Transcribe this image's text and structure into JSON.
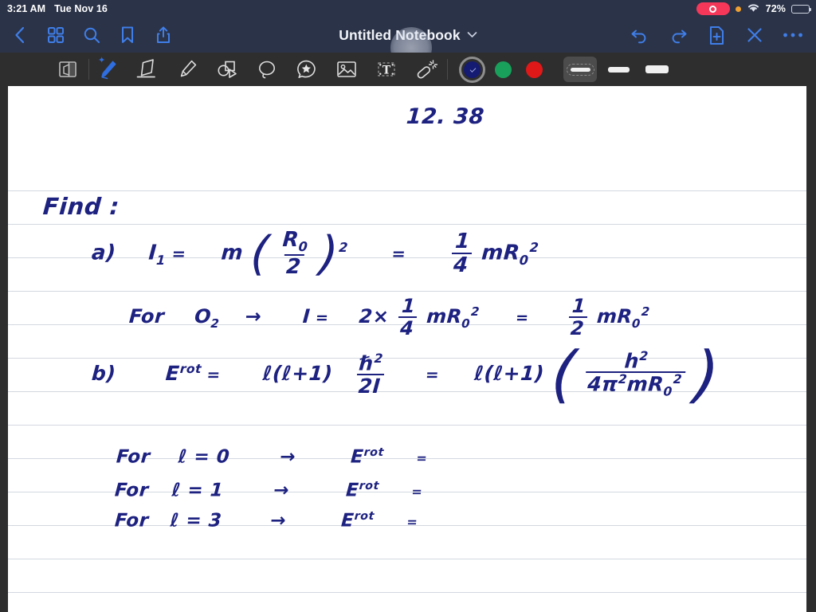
{
  "status_bar": {
    "time": "3:21 AM",
    "date": "Tue Nov 16",
    "battery_percent": "72%",
    "battery_level": 72,
    "recording_indicator": "recording-pill-icon",
    "privacy_dot": "orange-privacy-dot-icon",
    "wifi": "wifi-icon",
    "colors": {
      "bar_bg": "#2b3348",
      "recording_red": "#f5385a",
      "privacy_orange": "#f0a030"
    }
  },
  "nav_bar": {
    "title": "Untitled Notebook",
    "title_chevron": "chevron-down-icon",
    "left_icons": [
      {
        "name": "back-icon",
        "label": "Back"
      },
      {
        "name": "grid-icon",
        "label": "Page Grid"
      },
      {
        "name": "search-icon",
        "label": "Search"
      },
      {
        "name": "bookmark-icon",
        "label": "Bookmark"
      },
      {
        "name": "share-icon",
        "label": "Share"
      }
    ],
    "right_icons": [
      {
        "name": "undo-icon",
        "label": "Undo"
      },
      {
        "name": "redo-icon",
        "label": "Redo"
      },
      {
        "name": "new-page-icon",
        "label": "New Page"
      },
      {
        "name": "close-icon",
        "label": "Close"
      },
      {
        "name": "more-icon",
        "label": "More"
      }
    ],
    "touch_indicator": "touch-tap-indicator",
    "colors": {
      "bar_bg": "#2b3348",
      "icon_blue": "#3f7ee8",
      "title_text": "#f2f4f8"
    }
  },
  "tool_bar": {
    "background": "#2e2e2e",
    "tools": [
      {
        "name": "page-layers-tool",
        "label": "Page Layers",
        "selected": false
      },
      {
        "name": "pen-tool",
        "label": "Pen",
        "selected": true
      },
      {
        "name": "eraser-tool",
        "label": "Eraser",
        "selected": false
      },
      {
        "name": "highlighter-tool",
        "label": "Highlighter",
        "selected": false
      },
      {
        "name": "shapes-tool",
        "label": "Shapes",
        "selected": false
      },
      {
        "name": "lasso-tool",
        "label": "Lasso",
        "selected": false
      },
      {
        "name": "sticker-tool",
        "label": "Sticker",
        "selected": false
      },
      {
        "name": "image-tool",
        "label": "Image",
        "selected": false
      },
      {
        "name": "text-tool",
        "label": "Text",
        "selected": false
      },
      {
        "name": "magic-wand-tool",
        "label": "Magic Wand",
        "selected": false
      }
    ],
    "colors": [
      {
        "name": "color-swatch-navy",
        "hex": "#151a72",
        "selected": true
      },
      {
        "name": "color-swatch-green",
        "hex": "#19a05b",
        "selected": false
      },
      {
        "name": "color-swatch-red",
        "hex": "#e01818",
        "selected": false
      }
    ],
    "stroke_widths": [
      {
        "name": "stroke-width-thin",
        "label": "Thin",
        "selected": true
      },
      {
        "name": "stroke-width-medium",
        "label": "Medium",
        "selected": false
      },
      {
        "name": "stroke-width-thick",
        "label": "Thick",
        "selected": false
      }
    ]
  },
  "notebook_page": {
    "background": "#ffffff",
    "rule_color": "#d3d8e0",
    "rule_spacing": 42,
    "ink_color": "#1d2180",
    "problem_number": "12. 38",
    "lines": {
      "find_label": "Find :",
      "part_a_label": "a)",
      "part_b_label": "b)",
      "for_o2": "For",
      "o2_symbol": "O",
      "o2_sub": "2",
      "arrow": "→",
      "equals": "=",
      "I_symbol": "I",
      "I1_sub": "1",
      "m": "m",
      "R": "R",
      "R_sub": "0",
      "two": "2",
      "four": "4",
      "one": "1",
      "two_times": "2×",
      "E_symbol": "E",
      "rot_sup": "rot",
      "ell": "ℓ",
      "ell_plus_one": "(ℓ+1)",
      "hbar": "ℏ",
      "h_plain": "h",
      "two_I": "2I",
      "pi": "π",
      "four_pi_sq_m_R": "4",
      "for_label": "For",
      "ell_eq_0": "ℓ = 0",
      "ell_eq_1": "ℓ = 1",
      "ell_eq_3": "ℓ = 3"
    },
    "transcription": [
      "12. 38",
      "Find :",
      "a)  I₁ = m (R₀/2)²  =  ¼ m R₀²",
      "For O₂ → I = 2× ¼ m R₀² = ½ m R₀²",
      "b)  E^rot = ℓ(ℓ+1) ℏ²/2I , ℓ(ℓ+1) ( h² / 4π² m R₀² )",
      "For ℓ = 0 → E^rot =",
      "For ℓ = 1 → E^rot =",
      "For ℓ = 3 → E^rot ="
    ]
  }
}
